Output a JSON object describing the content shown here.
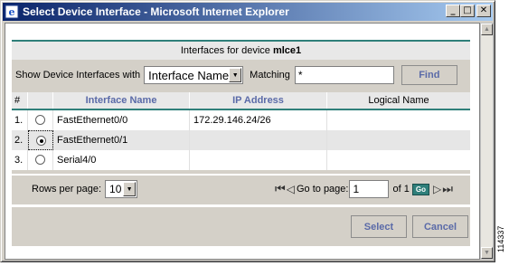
{
  "window": {
    "title": "Select Device Interface - Microsoft Internet Explorer"
  },
  "header": {
    "prefix": "Interfaces for device ",
    "device": "mlce1"
  },
  "filter": {
    "label": "Show Device Interfaces with",
    "select_value": "Interface Name",
    "matching_label": "Matching",
    "matching_value": "*",
    "find_label": "Find"
  },
  "table": {
    "columns": [
      "#",
      "Interface Name",
      "IP Address",
      "Logical Name"
    ],
    "rows": [
      {
        "num": "1.",
        "name": "FastEthernet0/0",
        "ip": "172.29.146.24/26",
        "logical": ""
      },
      {
        "num": "2.",
        "name": "FastEthernet0/1",
        "ip": "",
        "logical": ""
      },
      {
        "num": "3.",
        "name": "Serial4/0",
        "ip": "",
        "logical": ""
      }
    ],
    "selected_row_index": 1
  },
  "pager": {
    "rows_label": "Rows per page:",
    "rows_value": "10",
    "goto_label": "Go to page:",
    "page_value": "1",
    "of_label": "of 1",
    "go_label": "Go"
  },
  "actions": {
    "select_label": "Select",
    "cancel_label": "Cancel"
  },
  "side_text": "114337",
  "colors": {
    "teal": "#2f7f7a",
    "link_blue": "#5a6aa8",
    "titlebar": "#0a246a"
  }
}
